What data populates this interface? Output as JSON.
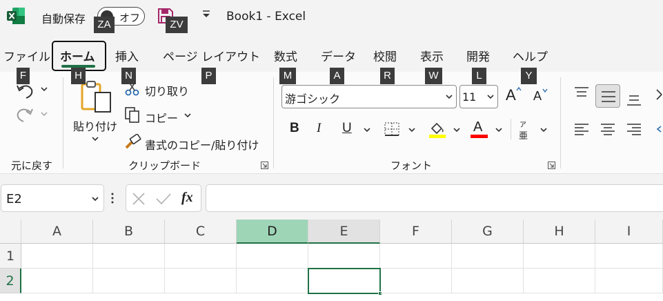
{
  "title_bar": {
    "autosave_label": "自動保存",
    "autosave_state": "オフ",
    "doc_title": "Book1 - Excel"
  },
  "keytips": {
    "autosave": "ZA",
    "save": "ZV",
    "file": "F",
    "home": "H",
    "insert": "N",
    "page_layout": "P",
    "formulas": "M",
    "data": "A",
    "review": "R",
    "view": "W",
    "developer": "L",
    "help": "Y"
  },
  "tabs": [
    {
      "label": "ファイル"
    },
    {
      "label": "ホーム",
      "selected": true
    },
    {
      "label": "挿入"
    },
    {
      "label": "ページ レイアウト"
    },
    {
      "label": "数式"
    },
    {
      "label": "データ"
    },
    {
      "label": "校閲"
    },
    {
      "label": "表示"
    },
    {
      "label": "開発"
    },
    {
      "label": "ヘルプ"
    }
  ],
  "ribbon": {
    "undo_group_label": "元に戻す",
    "clipboard": {
      "group_label": "クリップボード",
      "paste_label": "貼り付け",
      "cut_label": "切り取り",
      "copy_label": "コピー",
      "format_painter_label": "書式のコピー/貼り付け"
    },
    "font": {
      "group_label": "フォント",
      "font_name": "游ゴシック",
      "font_size": "11",
      "bold": "B",
      "italic": "I",
      "underline": "U",
      "font_color_glyph": "A",
      "phonetic_top": "ア",
      "phonetic_bottom": "亜",
      "grow_glyph": "A",
      "shrink_glyph": "A",
      "fill_color": "#ffff00",
      "font_color": "#ff0000"
    }
  },
  "formula_bar": {
    "name_box": "E2",
    "fx_label": "fx",
    "formula": ""
  },
  "grid": {
    "columns": [
      "A",
      "B",
      "C",
      "D",
      "E",
      "F",
      "G",
      "H",
      "I"
    ],
    "rows": [
      "1",
      "2"
    ],
    "selected_column": "D",
    "active_cell": "E2"
  },
  "colors": {
    "accent": "#1e7145",
    "selected_header": "#9fd5b7"
  }
}
